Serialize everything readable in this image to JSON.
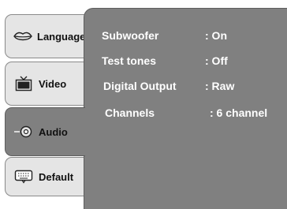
{
  "tabs": [
    {
      "label": "Language",
      "icon": "lips-icon"
    },
    {
      "label": "Video",
      "icon": "tv-icon"
    },
    {
      "label": "Audio",
      "icon": "speaker-icon",
      "active": true
    },
    {
      "label": "Default",
      "icon": "keyboard-icon"
    }
  ],
  "settings": [
    {
      "label": "Subwoofer",
      "value": ": On"
    },
    {
      "label": "Test tones",
      "value": ": Off"
    },
    {
      "label": "Digital Output",
      "value": ": Raw"
    },
    {
      "label": "Channels",
      "value": ": 6 channel"
    }
  ],
  "colors": {
    "panel": "#808080",
    "tab": "#e5e5e5",
    "text_on_panel": "#ffffff"
  }
}
